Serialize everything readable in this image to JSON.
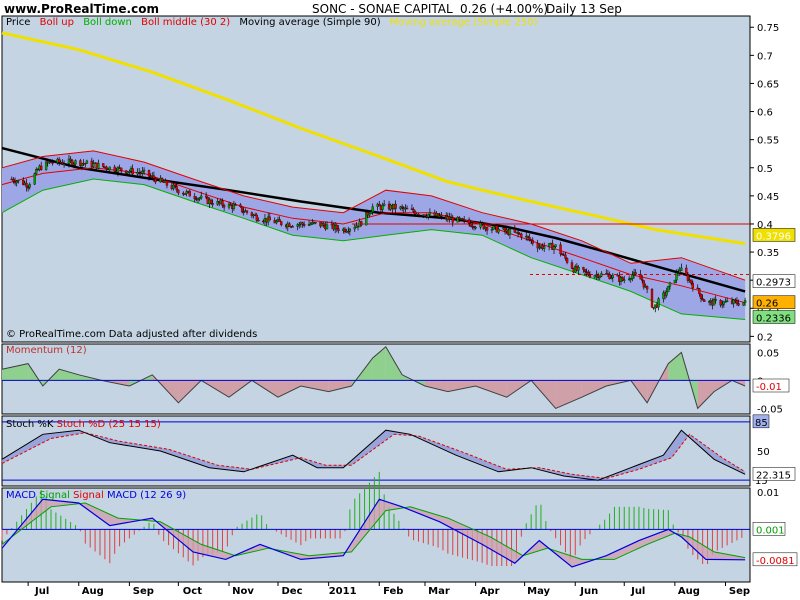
{
  "header": {
    "site": "www.ProRealTime.com",
    "symbol": "SONC - SONAE CAPITAL",
    "price": "0.26 (+4.00%)",
    "period": "Daily  13 Sep"
  },
  "legends": {
    "price": [
      "Price",
      "Boll up",
      "Boll down",
      "Boll middle (30 2)",
      "Moving average (Simple 90)",
      "Moving average (Simple 250)"
    ],
    "copyright": "© ProRealTime.com  Data adjusted after dividends",
    "momentum": "Momentum (12)",
    "stoch": [
      "Stoch %K",
      "Stoch %D (25 15 15)"
    ],
    "macd": [
      "MACD",
      "Signal",
      "Signal",
      "MACD (12 26 9)"
    ]
  },
  "colors": {
    "background": "#c4d4e2",
    "bollinger_fill": "#9ea7e6",
    "boll_up": "#e00000",
    "boll_down": "#00b000",
    "boll_middle": "#e00000",
    "ma90": "#000000",
    "ma250": "#f0e000",
    "candle_up": "#00a000",
    "candle_down": "#e00000",
    "momentum_pos": "#8fd08f",
    "momentum_neg": "#d0a0a8",
    "stoch_k": "#000000",
    "stoch_d": "#e00000",
    "macd_line": "#0000e0",
    "signal_line": "#00a000",
    "hist_pos": "#20b020",
    "hist_neg": "#e04040",
    "ref_line": "#0000cc"
  },
  "chart_data": [
    {
      "panel": "price",
      "type": "candlestick",
      "x": {
        "type": "date",
        "range": [
          "2010-06-15",
          "2011-09-16"
        ],
        "ticks": [
          {
            "label": "Jul",
            "date": "2010-07-01"
          },
          {
            "label": "Aug",
            "date": "2010-08-01"
          },
          {
            "label": "Sep",
            "date": "2010-09-01"
          },
          {
            "label": "Oct",
            "date": "2010-10-01"
          },
          {
            "label": "Nov",
            "date": "2010-11-01"
          },
          {
            "label": "Dec",
            "date": "2010-12-01"
          },
          {
            "label": "2011",
            "date": "2011-01-01"
          },
          {
            "label": "Feb",
            "date": "2011-02-01"
          },
          {
            "label": "Mar",
            "date": "2011-03-01"
          },
          {
            "label": "Apr",
            "date": "2011-04-01"
          },
          {
            "label": "May",
            "date": "2011-05-01"
          },
          {
            "label": "Jun",
            "date": "2011-06-01"
          },
          {
            "label": "Jul",
            "date": "2011-07-01"
          },
          {
            "label": "Aug",
            "date": "2011-08-01"
          },
          {
            "label": "Sep",
            "date": "2011-09-01"
          }
        ]
      },
      "y": {
        "range": [
          0.19,
          0.77
        ],
        "ticks": [
          "0.75",
          "0.7",
          "0.65",
          "0.6",
          "0.55",
          "0.5",
          "0.45",
          "0.4",
          "0.35",
          "0.3",
          "0.25",
          "0.2"
        ]
      },
      "close_points": [
        [
          "2010-06-21",
          0.48
        ],
        [
          "2010-07-01",
          0.47
        ],
        [
          "2010-07-08",
          0.5
        ],
        [
          "2010-07-15",
          0.51
        ],
        [
          "2010-08-01",
          0.51
        ],
        [
          "2010-08-20",
          0.5
        ],
        [
          "2010-09-10",
          0.49
        ],
        [
          "2010-10-01",
          0.46
        ],
        [
          "2010-10-20",
          0.44
        ],
        [
          "2010-11-05",
          0.43
        ],
        [
          "2010-11-20",
          0.41
        ],
        [
          "2010-12-05",
          0.4
        ],
        [
          "2010-12-25",
          0.4
        ],
        [
          "2011-01-10",
          0.39
        ],
        [
          "2011-01-20",
          0.4
        ],
        [
          "2011-01-28",
          0.43
        ],
        [
          "2011-02-10",
          0.43
        ],
        [
          "2011-02-25",
          0.42
        ],
        [
          "2011-03-15",
          0.41
        ],
        [
          "2011-03-30",
          0.4
        ],
        [
          "2011-04-15",
          0.39
        ],
        [
          "2011-04-30",
          0.38
        ],
        [
          "2011-05-10",
          0.36
        ],
        [
          "2011-05-20",
          0.36
        ],
        [
          "2011-05-31",
          0.32
        ],
        [
          "2011-06-10",
          0.31
        ],
        [
          "2011-06-20",
          0.31
        ],
        [
          "2011-06-30",
          0.3
        ],
        [
          "2011-07-06",
          0.31
        ],
        [
          "2011-07-12",
          0.3
        ],
        [
          "2011-07-19",
          0.25
        ],
        [
          "2011-07-27",
          0.28
        ],
        [
          "2011-08-04",
          0.32
        ],
        [
          "2011-08-10",
          0.3
        ],
        [
          "2011-08-20",
          0.26
        ],
        [
          "2011-09-01",
          0.26
        ],
        [
          "2011-09-13",
          0.26
        ]
      ],
      "boll_up": [
        [
          "2010-06-15",
          0.5
        ],
        [
          "2010-07-10",
          0.52
        ],
        [
          "2010-08-10",
          0.53
        ],
        [
          "2010-09-10",
          0.51
        ],
        [
          "2010-10-10",
          0.48
        ],
        [
          "2010-11-10",
          0.45
        ],
        [
          "2010-12-10",
          0.43
        ],
        [
          "2011-01-10",
          0.42
        ],
        [
          "2011-02-05",
          0.46
        ],
        [
          "2011-03-05",
          0.45
        ],
        [
          "2011-04-05",
          0.42
        ],
        [
          "2011-05-05",
          0.4
        ],
        [
          "2011-06-05",
          0.37
        ],
        [
          "2011-07-05",
          0.33
        ],
        [
          "2011-08-05",
          0.34
        ],
        [
          "2011-09-13",
          0.3
        ]
      ],
      "boll_middle": [
        [
          "2010-06-15",
          0.47
        ],
        [
          "2010-07-10",
          0.49
        ],
        [
          "2010-08-10",
          0.5
        ],
        [
          "2010-09-10",
          0.49
        ],
        [
          "2010-10-10",
          0.46
        ],
        [
          "2010-11-10",
          0.43
        ],
        [
          "2010-12-10",
          0.41
        ],
        [
          "2011-01-10",
          0.4
        ],
        [
          "2011-02-05",
          0.42
        ],
        [
          "2011-03-05",
          0.42
        ],
        [
          "2011-04-05",
          0.4
        ],
        [
          "2011-05-05",
          0.37
        ],
        [
          "2011-06-05",
          0.34
        ],
        [
          "2011-07-05",
          0.31
        ],
        [
          "2011-08-05",
          0.29
        ],
        [
          "2011-09-13",
          0.26
        ]
      ],
      "boll_down": [
        [
          "2010-06-15",
          0.42
        ],
        [
          "2010-07-10",
          0.46
        ],
        [
          "2010-08-10",
          0.48
        ],
        [
          "2010-09-10",
          0.47
        ],
        [
          "2010-10-10",
          0.44
        ],
        [
          "2010-11-10",
          0.41
        ],
        [
          "2010-12-10",
          0.38
        ],
        [
          "2011-01-10",
          0.37
        ],
        [
          "2011-02-05",
          0.38
        ],
        [
          "2011-03-05",
          0.39
        ],
        [
          "2011-04-05",
          0.38
        ],
        [
          "2011-05-05",
          0.34
        ],
        [
          "2011-06-05",
          0.31
        ],
        [
          "2011-07-05",
          0.28
        ],
        [
          "2011-08-05",
          0.24
        ],
        [
          "2011-09-13",
          0.23
        ]
      ],
      "ma90": [
        [
          "2010-06-15",
          0.535
        ],
        [
          "2010-08-01",
          0.5
        ],
        [
          "2010-09-15",
          0.48
        ],
        [
          "2010-11-01",
          0.46
        ],
        [
          "2010-12-15",
          0.44
        ],
        [
          "2011-02-01",
          0.42
        ],
        [
          "2011-03-15",
          0.41
        ],
        [
          "2011-04-20",
          0.395
        ],
        [
          "2011-05-20",
          0.375
        ],
        [
          "2011-06-20",
          0.35
        ],
        [
          "2011-07-20",
          0.325
        ],
        [
          "2011-09-13",
          0.28
        ]
      ],
      "ma250": [
        [
          "2010-06-15",
          0.74
        ],
        [
          "2010-08-01",
          0.71
        ],
        [
          "2010-09-15",
          0.67
        ],
        [
          "2010-11-01",
          0.62
        ],
        [
          "2010-12-15",
          0.57
        ],
        [
          "2011-02-01",
          0.52
        ],
        [
          "2011-03-15",
          0.475
        ],
        [
          "2011-04-20",
          0.45
        ],
        [
          "2011-05-20",
          0.43
        ],
        [
          "2011-06-20",
          0.41
        ],
        [
          "2011-07-20",
          0.39
        ],
        [
          "2011-09-13",
          0.365
        ]
      ],
      "horizontal_line": 0.4,
      "dotted_line": 0.31,
      "price_labels": [
        {
          "value": 0.3796,
          "text": "0.3796",
          "color": "#f0e000",
          "text_color": "#ffffff"
        },
        {
          "value": 0.2973,
          "text": "0.2973",
          "color": "#ffffff",
          "text_color": "#000000"
        },
        {
          "value": 0.26,
          "text": "0.26",
          "color": "#ffb000",
          "text_color": "#000000"
        },
        {
          "value": 0.2336,
          "text": "0.2336",
          "color": "#80e080",
          "text_color": "#000000"
        }
      ]
    },
    {
      "panel": "momentum",
      "type": "area",
      "y": {
        "range": [
          -0.06,
          0.065
        ],
        "ticks": [
          "0.05",
          "0",
          "-0.05"
        ]
      },
      "points": [
        [
          "2010-06-15",
          0.02
        ],
        [
          "2010-07-01",
          0.03
        ],
        [
          "2010-07-10",
          -0.01
        ],
        [
          "2010-07-20",
          0.02
        ],
        [
          "2010-08-01",
          0.01
        ],
        [
          "2010-08-15",
          0.0
        ],
        [
          "2010-09-01",
          -0.01
        ],
        [
          "2010-09-15",
          0.01
        ],
        [
          "2010-10-01",
          -0.04
        ],
        [
          "2010-10-15",
          0.0
        ],
        [
          "2010-11-01",
          -0.03
        ],
        [
          "2010-11-15",
          0.0
        ],
        [
          "2010-12-01",
          -0.03
        ],
        [
          "2010-12-15",
          -0.01
        ],
        [
          "2011-01-01",
          -0.02
        ],
        [
          "2011-01-15",
          -0.01
        ],
        [
          "2011-01-28",
          0.04
        ],
        [
          "2011-02-05",
          0.06
        ],
        [
          "2011-02-15",
          0.01
        ],
        [
          "2011-03-01",
          -0.01
        ],
        [
          "2011-03-15",
          -0.02
        ],
        [
          "2011-04-01",
          -0.01
        ],
        [
          "2011-04-20",
          -0.03
        ],
        [
          "2011-05-05",
          0.0
        ],
        [
          "2011-05-20",
          -0.05
        ],
        [
          "2011-06-05",
          -0.03
        ],
        [
          "2011-06-20",
          -0.01
        ],
        [
          "2011-07-05",
          0.0
        ],
        [
          "2011-07-15",
          -0.04
        ],
        [
          "2011-07-28",
          0.03
        ],
        [
          "2011-08-05",
          0.05
        ],
        [
          "2011-08-15",
          -0.05
        ],
        [
          "2011-08-25",
          -0.02
        ],
        [
          "2011-09-05",
          0.0
        ],
        [
          "2011-09-13",
          -0.01
        ]
      ],
      "last_label": "-0.01"
    },
    {
      "panel": "stoch",
      "type": "line",
      "y": {
        "range": [
          8,
          92
        ],
        "ticks": [
          "50"
        ]
      },
      "k": [
        [
          "2010-06-15",
          40
        ],
        [
          "2010-07-10",
          70
        ],
        [
          "2010-08-01",
          75
        ],
        [
          "2010-08-20",
          60
        ],
        [
          "2010-09-20",
          50
        ],
        [
          "2010-10-20",
          30
        ],
        [
          "2010-11-10",
          25
        ],
        [
          "2010-12-10",
          45
        ],
        [
          "2010-12-25",
          30
        ],
        [
          "2011-01-10",
          30
        ],
        [
          "2011-02-05",
          75
        ],
        [
          "2011-02-20",
          70
        ],
        [
          "2011-03-20",
          45
        ],
        [
          "2011-04-15",
          25
        ],
        [
          "2011-05-05",
          30
        ],
        [
          "2011-05-25",
          20
        ],
        [
          "2011-06-15",
          15
        ],
        [
          "2011-07-05",
          30
        ],
        [
          "2011-07-25",
          45
        ],
        [
          "2011-08-05",
          75
        ],
        [
          "2011-08-25",
          40
        ],
        [
          "2011-09-13",
          22
        ]
      ],
      "d": [
        [
          "2010-06-15",
          35
        ],
        [
          "2010-07-15",
          65
        ],
        [
          "2010-08-05",
          72
        ],
        [
          "2010-08-25",
          62
        ],
        [
          "2010-09-25",
          52
        ],
        [
          "2010-10-25",
          33
        ],
        [
          "2010-11-15",
          28
        ],
        [
          "2010-12-15",
          42
        ],
        [
          "2010-12-30",
          33
        ],
        [
          "2011-01-15",
          33
        ],
        [
          "2011-02-10",
          70
        ],
        [
          "2011-02-25",
          68
        ],
        [
          "2011-03-25",
          48
        ],
        [
          "2011-04-20",
          28
        ],
        [
          "2011-05-10",
          30
        ],
        [
          "2011-05-30",
          22
        ],
        [
          "2011-06-20",
          17
        ],
        [
          "2011-07-10",
          28
        ],
        [
          "2011-07-30",
          42
        ],
        [
          "2011-08-10",
          70
        ],
        [
          "2011-08-30",
          42
        ],
        [
          "2011-09-13",
          25
        ]
      ],
      "ref_levels": [
        85,
        15
      ],
      "label_85": "85",
      "label_15": "15",
      "last_label": "22.315"
    },
    {
      "panel": "macd",
      "type": "line",
      "y": {
        "range": [
          -0.014,
          0.011
        ],
        "ticks": [
          "0.01"
        ]
      },
      "macd": [
        [
          "2010-06-15",
          -0.005
        ],
        [
          "2010-07-10",
          0.008
        ],
        [
          "2010-08-01",
          0.007
        ],
        [
          "2010-08-20",
          0.001
        ],
        [
          "2010-09-15",
          0.003
        ],
        [
          "2010-10-10",
          -0.006
        ],
        [
          "2010-10-30",
          -0.008
        ],
        [
          "2010-11-20",
          -0.004
        ],
        [
          "2010-12-15",
          -0.008
        ],
        [
          "2011-01-10",
          -0.007
        ],
        [
          "2011-02-01",
          0.008
        ],
        [
          "2011-02-15",
          0.006
        ],
        [
          "2011-03-10",
          0.002
        ],
        [
          "2011-04-05",
          -0.004
        ],
        [
          "2011-04-25",
          -0.009
        ],
        [
          "2011-05-10",
          -0.003
        ],
        [
          "2011-05-30",
          -0.01
        ],
        [
          "2011-06-20",
          -0.007
        ],
        [
          "2011-07-10",
          -0.003
        ],
        [
          "2011-07-28",
          0.0
        ],
        [
          "2011-08-05",
          -0.002
        ],
        [
          "2011-08-20",
          -0.008
        ],
        [
          "2011-09-13",
          -0.0081
        ]
      ],
      "signal": [
        [
          "2010-06-15",
          -0.004
        ],
        [
          "2010-07-15",
          0.006
        ],
        [
          "2010-08-05",
          0.007
        ],
        [
          "2010-08-25",
          0.003
        ],
        [
          "2010-09-20",
          0.002
        ],
        [
          "2010-10-15",
          -0.004
        ],
        [
          "2010-11-05",
          -0.007
        ],
        [
          "2010-11-25",
          -0.005
        ],
        [
          "2010-12-20",
          -0.007
        ],
        [
          "2011-01-15",
          -0.006
        ],
        [
          "2011-02-05",
          0.005
        ],
        [
          "2011-02-20",
          0.006
        ],
        [
          "2011-03-15",
          0.003
        ],
        [
          "2011-04-10",
          -0.002
        ],
        [
          "2011-04-30",
          -0.007
        ],
        [
          "2011-05-15",
          -0.005
        ],
        [
          "2011-06-05",
          -0.008
        ],
        [
          "2011-06-25",
          -0.008
        ],
        [
          "2011-07-15",
          -0.004
        ],
        [
          "2011-08-01",
          -0.001
        ],
        [
          "2011-08-10",
          -0.002
        ],
        [
          "2011-08-25",
          -0.006
        ],
        [
          "2011-09-13",
          -0.0075
        ]
      ],
      "last_label": "-0.0081",
      "signal_label": "0.001"
    }
  ]
}
